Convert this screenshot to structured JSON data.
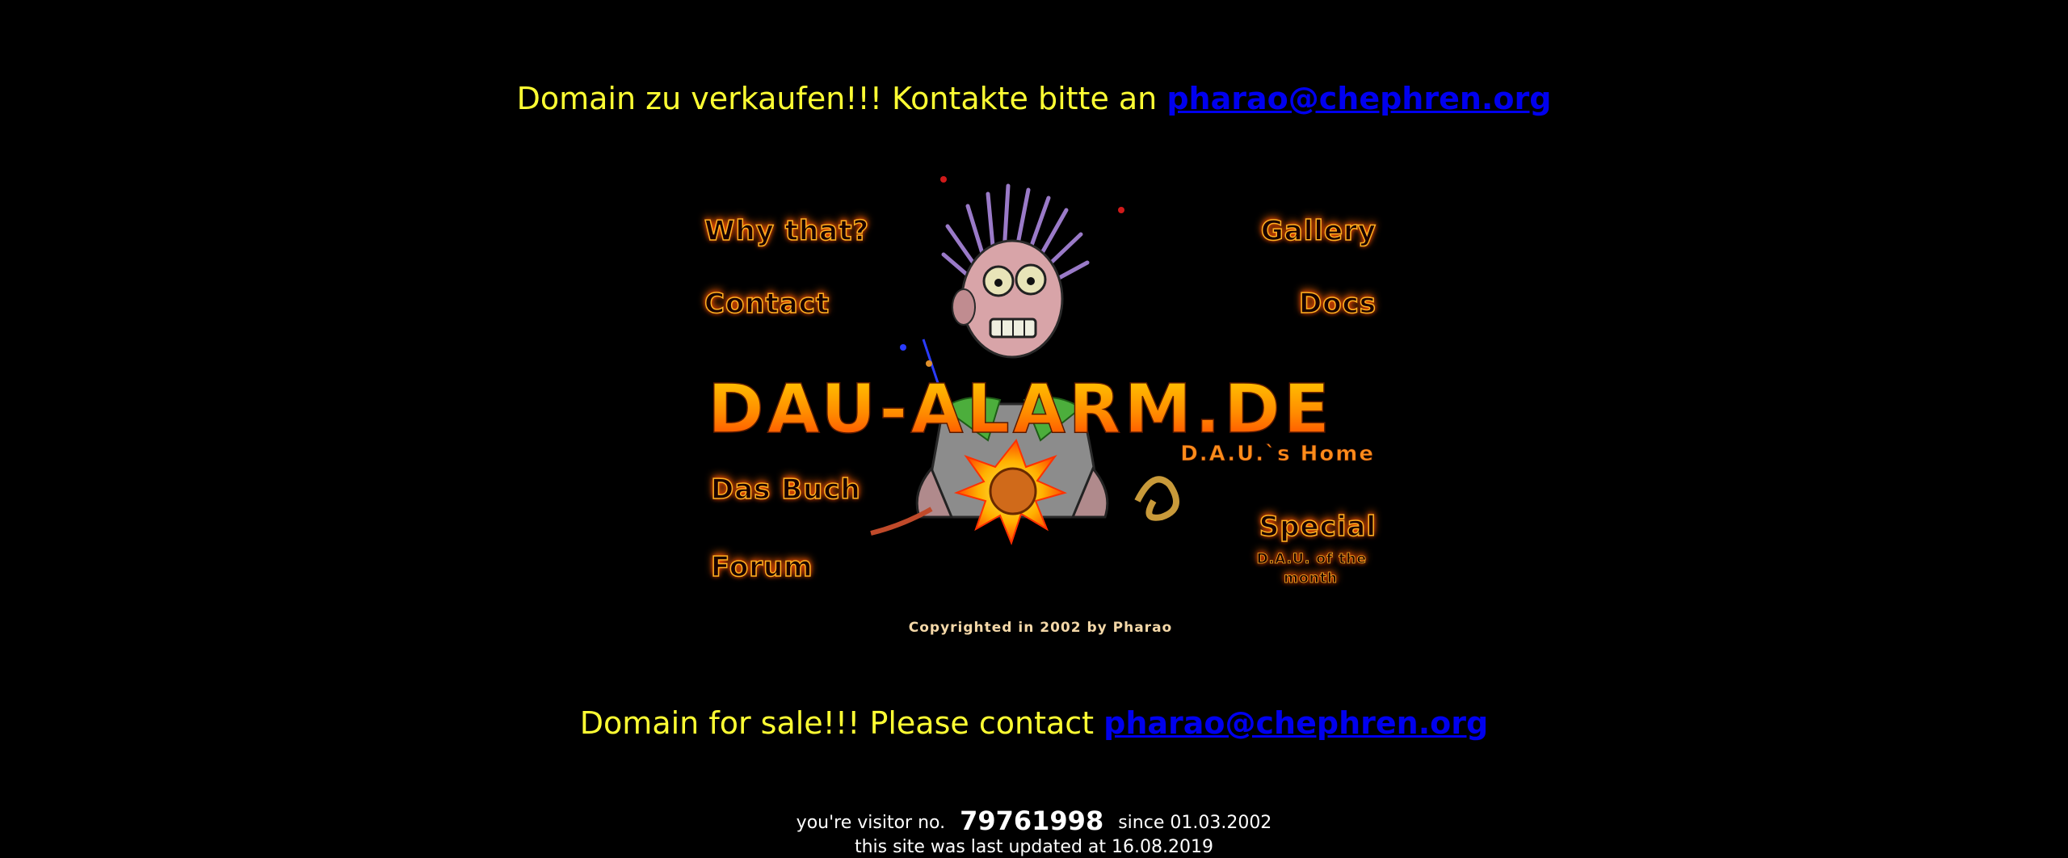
{
  "notices": {
    "german_prefix": "Domain zu verkaufen!!! Kontakte bitte an ",
    "english_prefix": "Domain for sale!!! Please contact ",
    "email": "pharao@chephren.org"
  },
  "splash": {
    "brand_title": "DAU-ALARM.DE",
    "brand_subtitle": "D.A.U.`s Home",
    "copyright": "Copyrighted in 2002 by Pharao",
    "nav": {
      "why": "Why that?",
      "contact": "Contact",
      "buch": "Das Buch",
      "forum": "Forum",
      "gallery": "Gallery",
      "docs": "Docs",
      "special": "Special",
      "special_sub_1": "D.A.U. of the",
      "special_sub_2": "month"
    }
  },
  "footer": {
    "visitor_label": "you're visitor no.",
    "visitor_count": "79761998",
    "since_label": "since 01.03.2002",
    "updated_label": "this site was last updated at 16.08.2019"
  },
  "colors": {
    "background": "#000000",
    "notice_text": "#ffff33",
    "link": "#0000ee",
    "footer_text": "#ffffff",
    "brand_orange": "#ff8c00",
    "flame_red": "#ff2a00"
  }
}
